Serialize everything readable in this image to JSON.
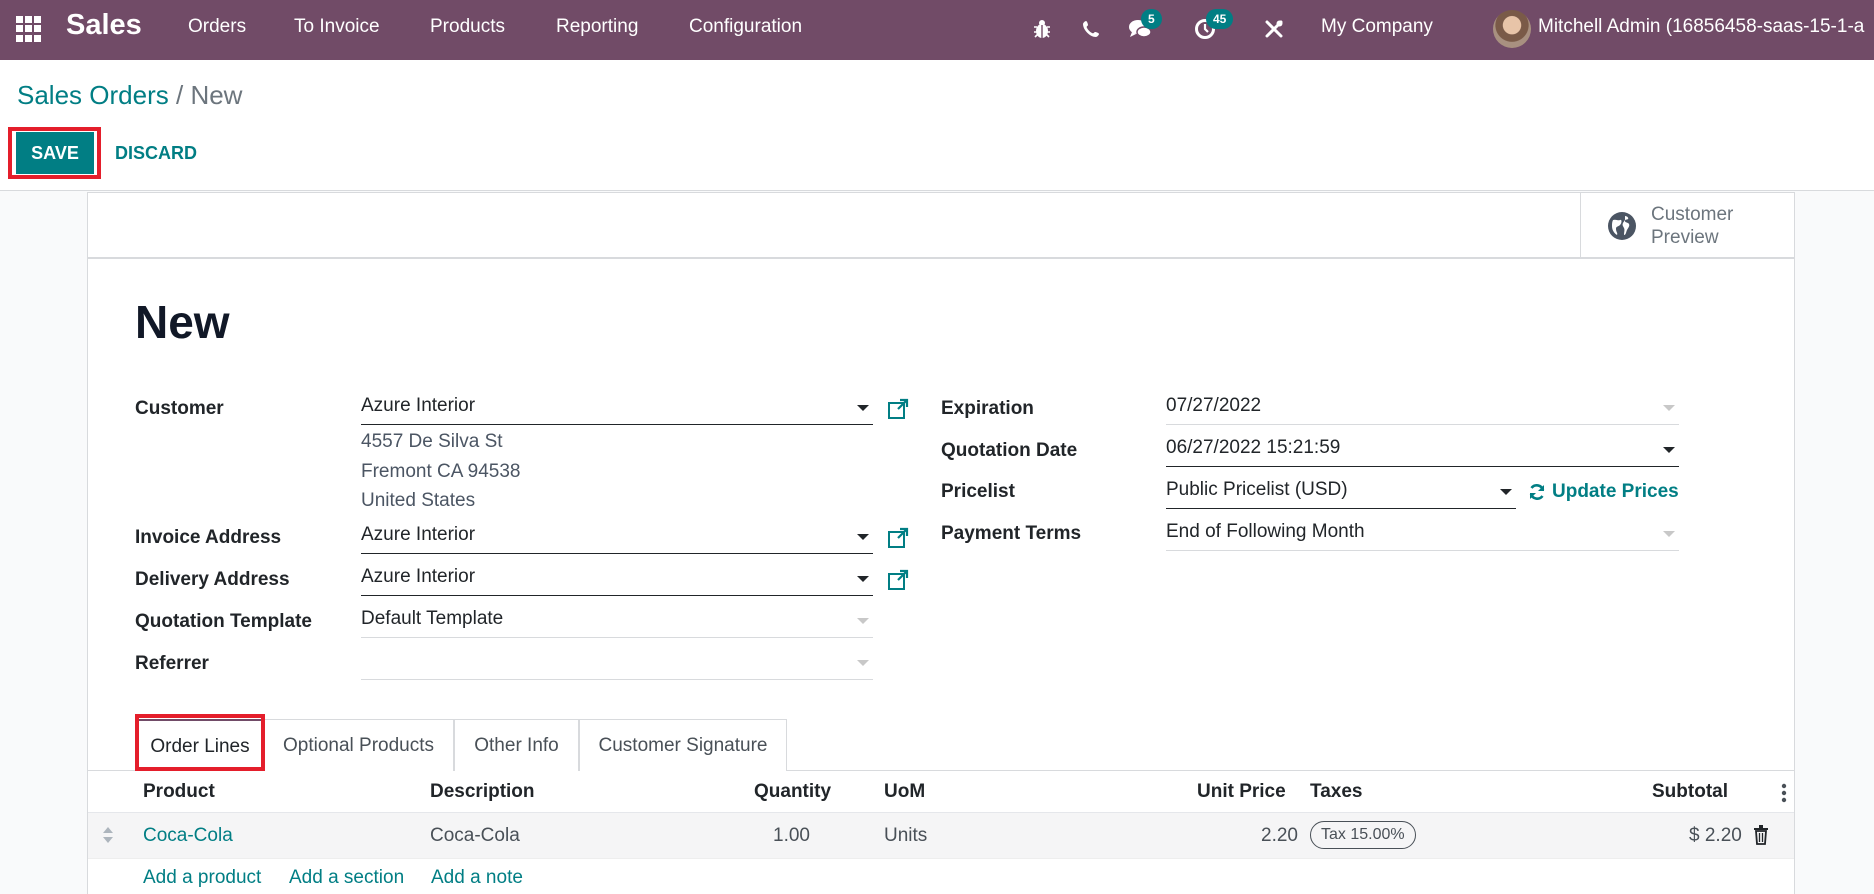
{
  "navbar": {
    "app_name": "Sales",
    "menu": [
      "Orders",
      "To Invoice",
      "Products",
      "Reporting",
      "Configuration"
    ],
    "icons": {
      "debug": "bug-icon",
      "phone": "phone-icon",
      "messages": "chat-icon",
      "activities": "clock-icon",
      "tools": "tools-icon"
    },
    "messages_count": "5",
    "activities_count": "45",
    "company": "My Company",
    "user": "Mitchell Admin (16856458-saas-15-1-a"
  },
  "breadcrumb": {
    "parent": "Sales Orders",
    "separator": "/",
    "current": "New"
  },
  "actions": {
    "save": "SAVE",
    "discard": "DISCARD"
  },
  "smart_button": {
    "line1": "Customer",
    "line2": "Preview"
  },
  "record": {
    "title": "New"
  },
  "left_fields": {
    "customer": {
      "label": "Customer",
      "value": "Azure Interior",
      "address": [
        "4557 De Silva St",
        "Fremont CA 94538",
        "United States"
      ]
    },
    "invoice_address": {
      "label": "Invoice Address",
      "value": "Azure Interior"
    },
    "delivery_address": {
      "label": "Delivery Address",
      "value": "Azure Interior"
    },
    "quotation_template": {
      "label": "Quotation Template",
      "value": "Default Template"
    },
    "referrer": {
      "label": "Referrer",
      "value": ""
    }
  },
  "right_fields": {
    "expiration": {
      "label": "Expiration",
      "value": "07/27/2022"
    },
    "quotation_date": {
      "label": "Quotation Date",
      "value": "06/27/2022 15:21:59"
    },
    "pricelist": {
      "label": "Pricelist",
      "value": "Public Pricelist (USD)"
    },
    "payment_terms": {
      "label": "Payment Terms",
      "value": "End of Following Month"
    }
  },
  "update_prices": "Update Prices",
  "tabs": [
    {
      "label": "Order Lines",
      "active": true
    },
    {
      "label": "Optional Products",
      "active": false
    },
    {
      "label": "Other Info",
      "active": false
    },
    {
      "label": "Customer Signature",
      "active": false
    }
  ],
  "order_lines": {
    "columns": [
      "Product",
      "Description",
      "Quantity",
      "UoM",
      "Unit Price",
      "Taxes",
      "Subtotal"
    ],
    "rows": [
      {
        "product": "Coca-Cola",
        "description": "Coca-Cola",
        "quantity": "1.00",
        "uom": "Units",
        "unit_price": "2.20",
        "taxes": "Tax 15.00%",
        "subtotal": "$ 2.20"
      }
    ],
    "add_links": [
      "Add a product",
      "Add a section",
      "Add a note"
    ]
  },
  "colors": {
    "brand": "#714b67",
    "accent": "#017e84",
    "highlight": "#e41e2b"
  }
}
